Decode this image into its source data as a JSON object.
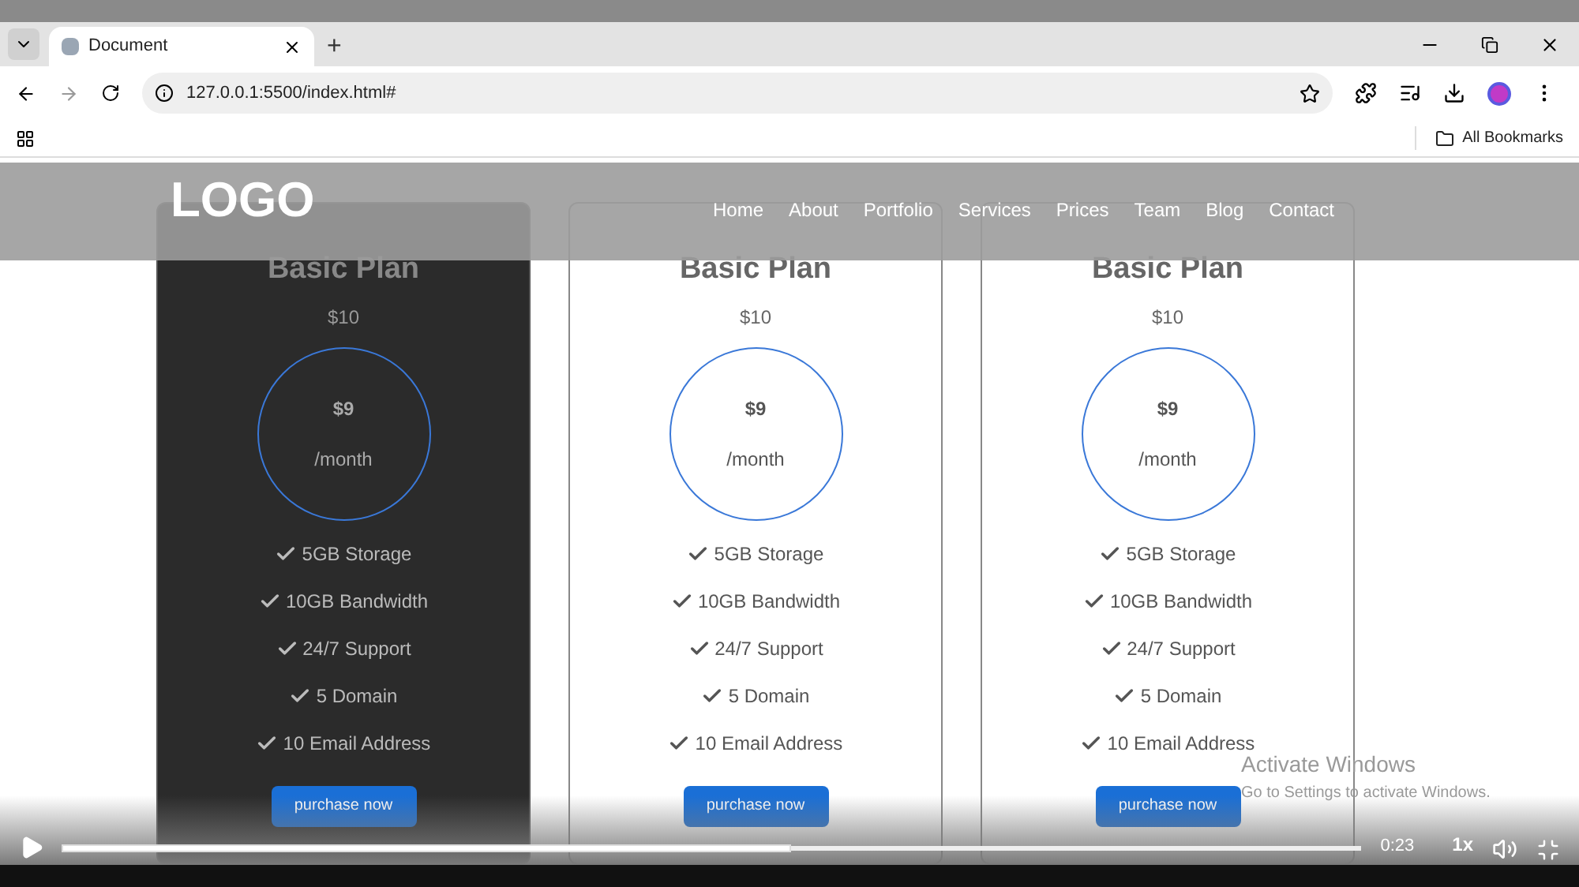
{
  "browser": {
    "tabs": [
      {
        "title": "Document",
        "selected": true
      }
    ],
    "new_tab": "+",
    "address": "127.0.0.1:5500/index.html#",
    "bookmarks": [
      "All Bookmarks"
    ]
  },
  "page": {
    "logo": "LOGO",
    "nav": [
      "Home",
      "About",
      "Portfolio",
      "Services",
      "Prices",
      "Team",
      "Blog",
      "Contact"
    ],
    "plans": [
      {
        "title": "Basic Plan",
        "old_price": "$10",
        "price": "$9",
        "period": "/month",
        "features": [
          "5GB Storage",
          "10GB Bandwidth",
          "24/7 Support",
          "5 Domain",
          "10 Email Address"
        ],
        "button": "purchase now",
        "highlighted": true
      },
      {
        "title": "Basic Plan",
        "old_price": "$10",
        "price": "$9",
        "period": "/month",
        "features": [
          "5GB Storage",
          "10GB Bandwidth",
          "24/7 Support",
          "5 Domain",
          "10 Email Address"
        ],
        "button": "purchase now",
        "highlighted": false
      },
      {
        "title": "Basic Plan",
        "old_price": "$10",
        "price": "$9",
        "period": "/month",
        "features": [
          "5GB Storage",
          "10GB Bandwidth",
          "24/7 Support",
          "5 Domain",
          "10 Email Address"
        ],
        "button": "purchase now",
        "highlighted": false
      }
    ]
  },
  "os_notice": {
    "title": "Activate Windows",
    "subtitle": "Go to Settings to activate Windows."
  },
  "player": {
    "level": 0.56,
    "time": "0:23",
    "speed": "1x"
  }
}
